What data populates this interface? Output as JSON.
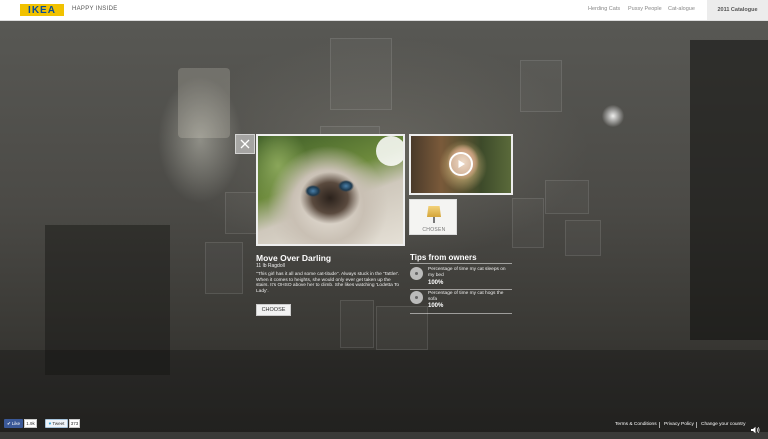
{
  "header": {
    "logo": "IKEA",
    "tagline": "HAPPY INSIDE",
    "nav": [
      "Herding Cats",
      "Pussy People",
      "Cat-alogue"
    ],
    "catalogue": "2011 Catalogue"
  },
  "card": {
    "chosen_label": "CHOSEN",
    "cat_name": "Move Over Darling",
    "cat_meta": "11 lb Ragdoll",
    "description": "\"This girl has it all and some cat-titude\". Always stuck in the 'Tattler'. When it comes to heights, she would only ever get taken up the stairs. It's OHSO above her to climb. She likes watching 'Lodetta To Lady'.",
    "choose_label": "CHOOSE"
  },
  "tips": {
    "title": "Tips from owners",
    "items": [
      {
        "text": "Percentage of time my cat sleeps on my bed",
        "value": "100%"
      },
      {
        "text": "Percentage of time my cat hogs the sofa",
        "value": "100%"
      }
    ]
  },
  "footer": {
    "like_label": "Like",
    "like_count": "1.9k",
    "tweet_label": "Tweet",
    "tweet_count": "373",
    "links": [
      "Terms & Conditions",
      "Privacy Policy",
      "Change your country"
    ]
  },
  "colors": {
    "brand_yellow": "#f1c200",
    "brand_blue": "#0a4d96"
  },
  "icons": [
    "close-icon",
    "play-icon",
    "lamp-icon",
    "paw-icon",
    "speaker-icon",
    "facebook-like-icon",
    "twitter-icon"
  ]
}
